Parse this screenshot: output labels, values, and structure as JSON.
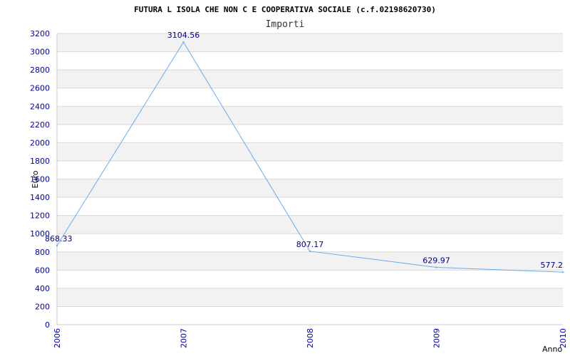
{
  "title": "FUTURA L ISOLA CHE NON C E COOPERATIVA SOCIALE (c.f.02198620730)",
  "subtitle": "Importi",
  "colors": {
    "line": "#6aaaf0",
    "band": "#f2f2f2",
    "grid": "#d8d8d8",
    "tick_text": "#0000aa",
    "data_label": "#000080"
  },
  "chart_data": {
    "type": "line",
    "x": [
      "2006",
      "2007",
      "2008",
      "2009",
      "2010"
    ],
    "values": [
      868.33,
      3104.56,
      807.17,
      629.97,
      577.2
    ],
    "value_labels": [
      "868.33",
      "3104.56",
      "807.17",
      "629.97",
      "577.2"
    ],
    "yticks": [
      "0",
      "200",
      "400",
      "600",
      "800",
      "1000",
      "1200",
      "1400",
      "1600",
      "1800",
      "2000",
      "2200",
      "2400",
      "2600",
      "2800",
      "3000",
      "3200"
    ],
    "ylim": [
      0,
      3200
    ],
    "xlabel": "Anno",
    "ylabel": "Euro",
    "grid": true
  }
}
